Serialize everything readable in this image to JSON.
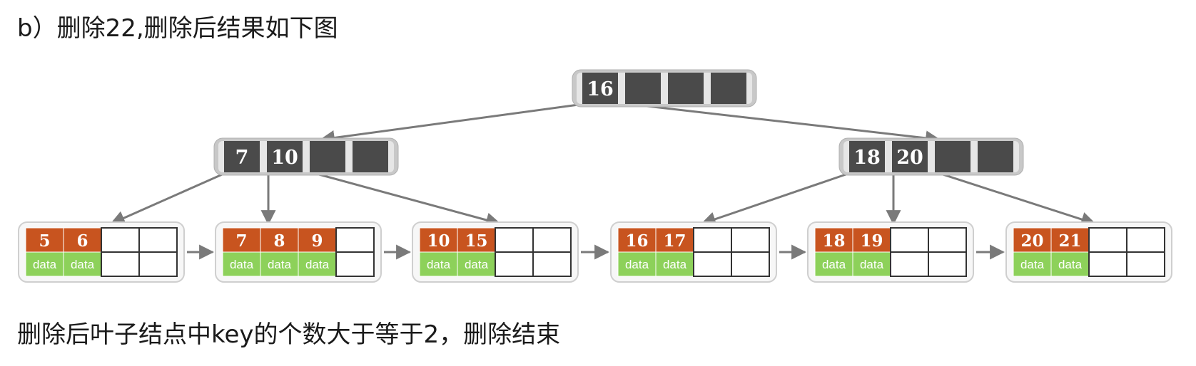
{
  "header": {
    "title": "b）删除22,删除后结果如下图"
  },
  "footer": {
    "note": "删除后叶子结点中key的个数大于等于2，删除结束"
  },
  "tree": {
    "root": {
      "keys": [
        "16"
      ],
      "slots": 4
    },
    "internal": [
      {
        "keys": [
          "7",
          "10"
        ],
        "slots": 4
      },
      {
        "keys": [
          "18",
          "20"
        ],
        "slots": 4
      }
    ],
    "leaves": [
      {
        "keys": [
          "5",
          "6"
        ],
        "slots": 4
      },
      {
        "keys": [
          "7",
          "8",
          "9"
        ],
        "slots": 4
      },
      {
        "keys": [
          "10",
          "15"
        ],
        "slots": 4
      },
      {
        "keys": [
          "16",
          "17"
        ],
        "slots": 4
      },
      {
        "keys": [
          "18",
          "19"
        ],
        "slots": 4
      },
      {
        "keys": [
          "20",
          "21"
        ],
        "slots": 4
      }
    ],
    "data_label": "data",
    "colors": {
      "internal_key": "#4a4a4a",
      "internal_frame": "#c8c8c8",
      "leaf_key": "#c8541f",
      "leaf_data": "#8dd15a",
      "leaf_frame": "#cfcfcf",
      "edge": "#7a7a7a",
      "empty_border": "#333333"
    }
  }
}
